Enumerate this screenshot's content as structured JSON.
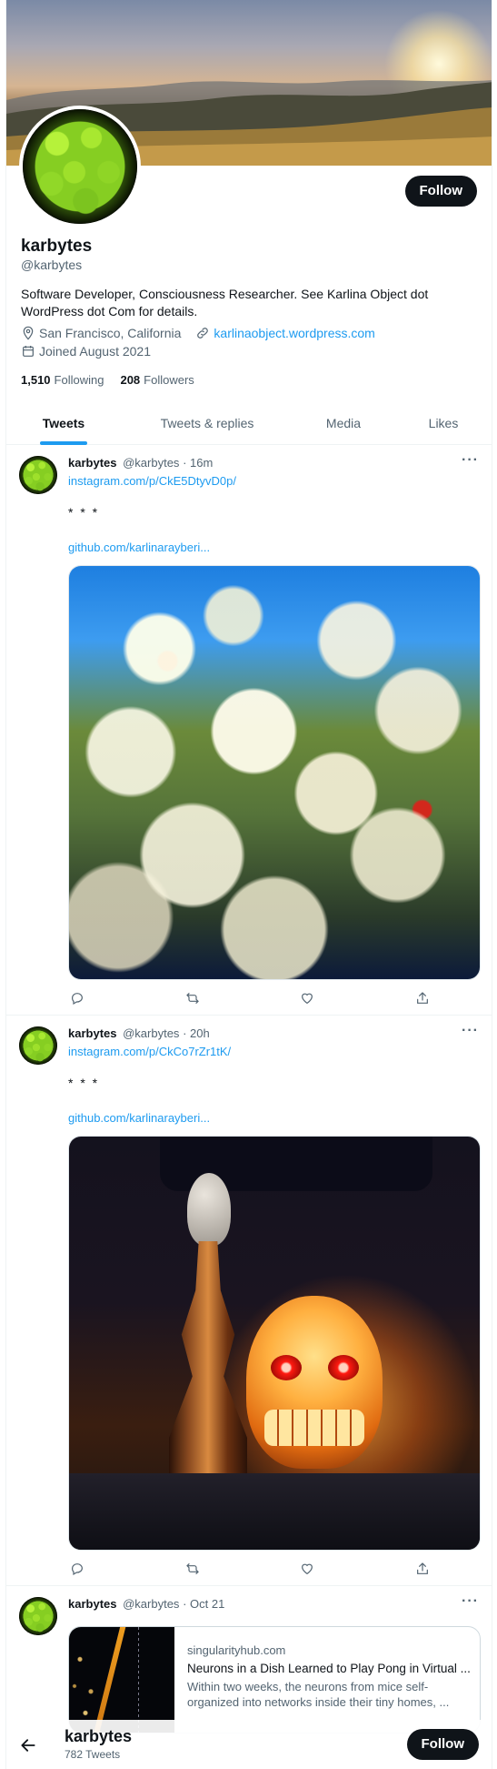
{
  "profile": {
    "name": "karbytes",
    "handle": "@karbytes",
    "bio": "Software Developer, Consciousness Researcher. See Karlina Object dot WordPress dot Com for details.",
    "location": "San Francisco, California",
    "website": "karlinaobject.wordpress.com",
    "joined": "Joined August 2021",
    "following_count": "1,510",
    "following_label": "Following",
    "followers_count": "208",
    "followers_label": "Followers",
    "follow_label": "Follow"
  },
  "tabs": [
    "Tweets",
    "Tweets & replies",
    "Media",
    "Likes"
  ],
  "tweets": [
    {
      "name": "karbytes",
      "handle": "@karbytes",
      "time": "· 16m",
      "link1": "instagram.com/p/CkE5DtyvD0p/",
      "dots": "* * *",
      "link2": "github.com/karlinarayberi..."
    },
    {
      "name": "karbytes",
      "handle": "@karbytes",
      "time": "· 20h",
      "link1": "instagram.com/p/CkCo7rZr1tK/",
      "dots": "* * *",
      "link2": "github.com/karlinarayberi..."
    },
    {
      "name": "karbytes",
      "handle": "@karbytes",
      "time": "· Oct 21",
      "card": {
        "domain": "singularityhub.com",
        "title": "Neurons in a Dish Learned to Play Pong in Virtual ...",
        "description": "Within two weeks, the neurons from mice self-organized into networks inside their tiny homes, ..."
      }
    }
  ],
  "more_label": "···",
  "sticky": {
    "name": "karbytes",
    "tweet_count": "782 Tweets",
    "follow_label": "Follow"
  },
  "colors": {
    "accent": "#1d9bf0",
    "text": "#0f1419",
    "secondary": "#536471",
    "button": "#0f1419"
  }
}
